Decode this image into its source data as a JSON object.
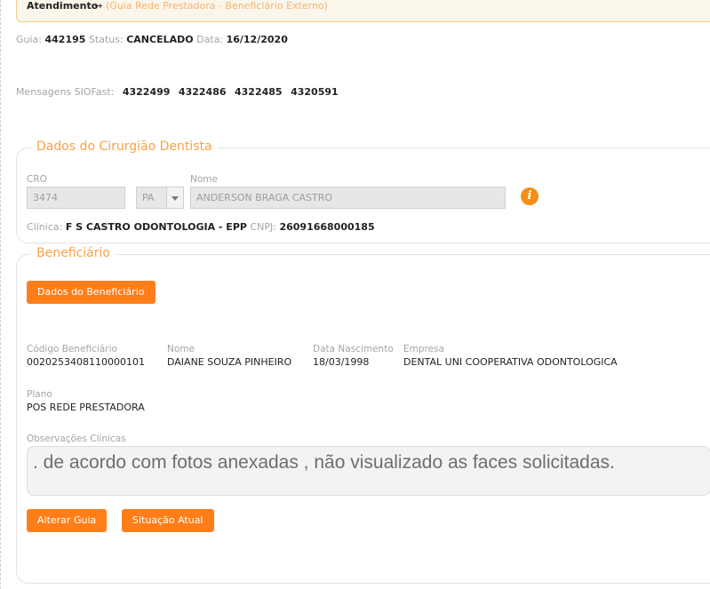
{
  "header": {
    "title": "Atendimento",
    "arrow": "→",
    "subtitle": "(Guia Rede Prestadora - Beneficiário Externo)"
  },
  "guia_info": {
    "guia_label": "Guia:",
    "guia_value": "442195",
    "status_label": "Status:",
    "status_value": "CANCELADO",
    "data_label": "Data:",
    "data_value": "16/12/2020"
  },
  "mensagens": {
    "label": "Mensagens SIOFast:",
    "items": [
      "4322499",
      "4322486",
      "4322485",
      "4320591"
    ]
  },
  "dentista": {
    "legend": "Dados do Cirurgião Dentista",
    "cro_label": "CRO",
    "cro_value": "3474",
    "uf_value": "PA",
    "nome_label": "Nome",
    "nome_value": "ANDERSON BRAGA CASTRO",
    "info_icon_glyph": "i",
    "clinica_label": "Clínica:",
    "clinica_value": "F S CASTRO ODONTOLOGIA - EPP",
    "cnpj_label": "CNPJ:",
    "cnpj_value": "26091668000185"
  },
  "beneficiario": {
    "legend": "Beneficiário",
    "dados_button": "Dados do Beneficiário",
    "codigo_label": "Código Beneficiário",
    "codigo_value": "0020253408110000101",
    "nome_label": "Nome",
    "nome_value": "DAIANE SOUZA PINHEIRO",
    "nascimento_label": "Data Nascimento",
    "nascimento_value": "18/03/1998",
    "empresa_label": "Empresa",
    "empresa_value": "DENTAL UNI COOPERATIVA ODONTOLOGICA",
    "plano_label": "Plano",
    "plano_value": "POS REDE PRESTADORA",
    "obs_label": "Observações Clínicas",
    "obs_value": ". de acordo com fotos anexadas , não visualizado as faces solicitadas."
  },
  "actions": {
    "alterar_label": "Alterar Guia",
    "situacao_label": "Situação Atual"
  },
  "colors": {
    "accent": "#ff7e1a",
    "legend": "#f7a147",
    "header_bg": "#fbf6ec"
  }
}
